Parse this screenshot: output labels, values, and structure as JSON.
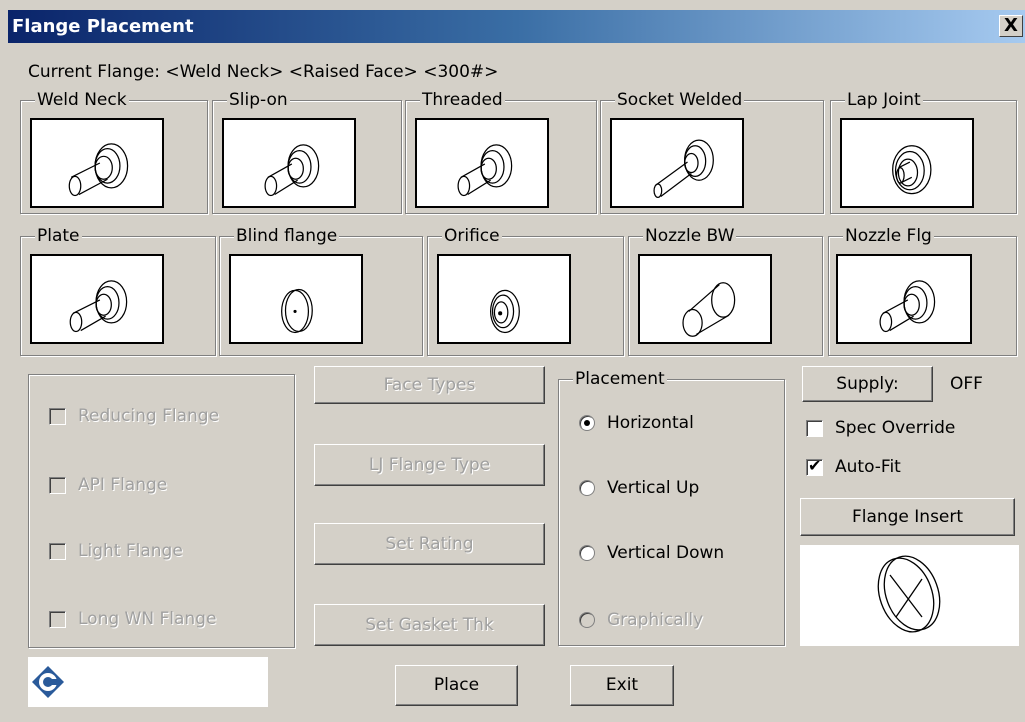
{
  "window": {
    "title": "Flange Placement",
    "close_glyph": "X"
  },
  "current_flange": "Current Flange: <Weld Neck> <Raised Face> <300#>",
  "flange_types_row1": [
    {
      "label": "Weld Neck",
      "icon": "weld-neck-flange-icon"
    },
    {
      "label": "Slip-on",
      "icon": "slip-on-flange-icon"
    },
    {
      "label": "Threaded",
      "icon": "threaded-flange-icon"
    },
    {
      "label": "Socket Welded",
      "icon": "socket-welded-flange-icon"
    },
    {
      "label": "Lap Joint",
      "icon": "lap-joint-flange-icon"
    }
  ],
  "flange_types_row2": [
    {
      "label": "Plate",
      "icon": "plate-flange-icon"
    },
    {
      "label": "Blind flange",
      "icon": "blind-flange-icon"
    },
    {
      "label": "Orifice",
      "icon": "orifice-flange-icon"
    },
    {
      "label": "Nozzle BW",
      "icon": "nozzle-bw-icon"
    },
    {
      "label": "Nozzle Flg",
      "icon": "nozzle-flg-icon"
    }
  ],
  "options": {
    "reducing": {
      "label": "Reducing Flange",
      "checked": false,
      "enabled": false
    },
    "api": {
      "label": "API Flange",
      "checked": false,
      "enabled": false
    },
    "light": {
      "label": "Light Flange",
      "checked": false,
      "enabled": false
    },
    "long_wn": {
      "label": "Long WN Flange",
      "checked": false,
      "enabled": false
    }
  },
  "buttons": {
    "face_types": "Face Types",
    "lj_flange_type": "LJ Flange Type",
    "set_rating": "Set Rating",
    "set_gasket_thk": "Set Gasket Thk",
    "supply": "Supply:",
    "flange_insert": "Flange Insert",
    "place": "Place",
    "exit": "Exit"
  },
  "placement": {
    "label": "Placement",
    "horizontal": "Horizontal",
    "vertical_up": "Vertical Up",
    "vertical_down": "Vertical Down",
    "graphically": "Graphically",
    "selected": "Horizontal"
  },
  "supply_value": "OFF",
  "spec_override": {
    "label": "Spec Override",
    "checked": false
  },
  "auto_fit": {
    "label": "Auto-Fit",
    "checked": true,
    "tick": "✔"
  },
  "preview_icon": "flange-insert-preview-icon",
  "logo_icon": "company-logo-icon"
}
